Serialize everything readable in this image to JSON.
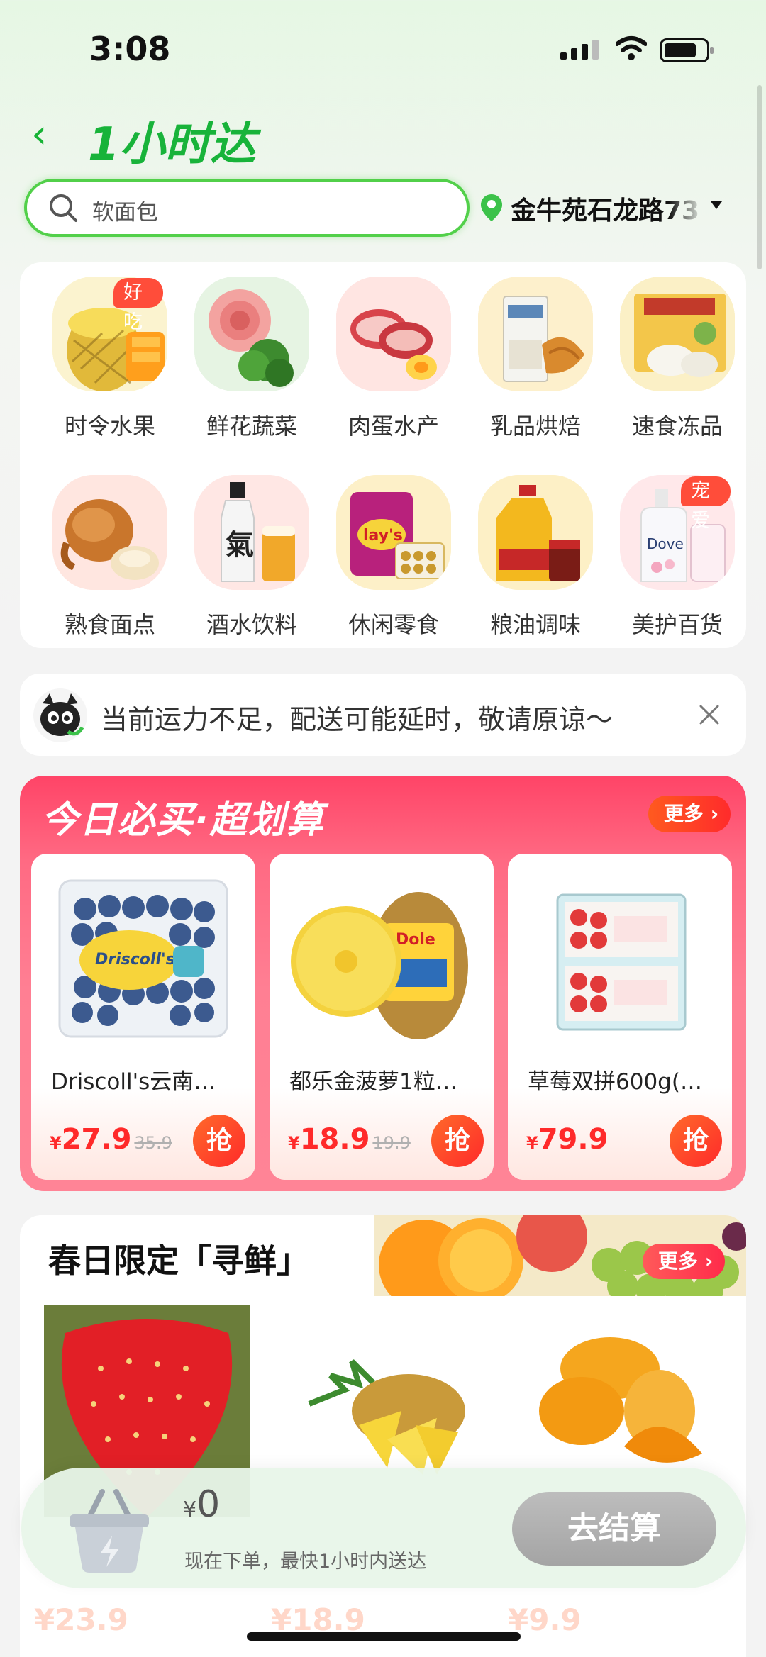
{
  "status_bar": {
    "time": "3:08"
  },
  "header": {
    "back": "‹",
    "title": "1小时达"
  },
  "search": {
    "placeholder": "软面包",
    "location": "金牛苑石龙路73"
  },
  "categories": [
    {
      "label": "时令水果",
      "badge": "好吃"
    },
    {
      "label": "鲜花蔬菜"
    },
    {
      "label": "肉蛋水产"
    },
    {
      "label": "乳品烘焙"
    },
    {
      "label": "速食冻品"
    },
    {
      "label": "熟食面点"
    },
    {
      "label": "酒水饮料"
    },
    {
      "label": "休闲零食"
    },
    {
      "label": "粮油调味"
    },
    {
      "label": "美护百货",
      "badge": "宠爱"
    }
  ],
  "notice": {
    "text": "当前运力不足，配送可能延时，敬请原谅～"
  },
  "deals": {
    "title": "今日必买·超划算",
    "more": "更多",
    "items": [
      {
        "name": "Driscoll's云南…",
        "currency": "¥",
        "price": "27.9",
        "old_price": "35.9",
        "button": "抢"
      },
      {
        "name": "都乐金菠萝1粒…",
        "currency": "¥",
        "price": "18.9",
        "old_price": "19.9",
        "button": "抢"
      },
      {
        "name": "草莓双拼600g(…",
        "currency": "¥",
        "price": "79.9",
        "old_price": "",
        "button": "抢"
      }
    ]
  },
  "spring": {
    "title": "春日限定「寻鲜」",
    "more": "更多"
  },
  "checkout": {
    "currency": "¥",
    "total": "0",
    "eta": "现在下单，最快1小时内送达",
    "button": "去结算"
  },
  "colors": {
    "brand_green": "#18b33a",
    "deal_red": "#ff2a2a",
    "deal_bg": "#ff5a78"
  }
}
